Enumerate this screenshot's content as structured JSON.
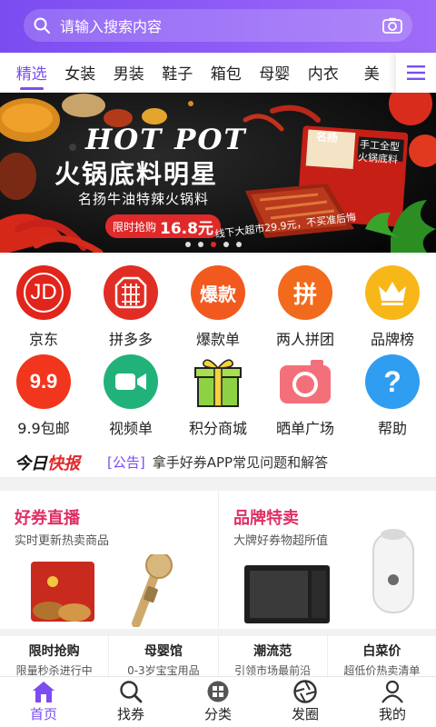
{
  "search": {
    "placeholder": "请输入搜索内容"
  },
  "tabs": [
    "精选",
    "女装",
    "男装",
    "鞋子",
    "箱包",
    "母婴",
    "内衣",
    "美"
  ],
  "banner": {
    "title": "HOT POT",
    "main": "火锅底料明星",
    "sub": "名扬牛油特辣火锅料",
    "price_label": "限时抢购",
    "price": "16.8元",
    "note": "线下大超市29.9元，不买准后悔",
    "pack_text_1": "名扬",
    "pack_text_2": "手工全型",
    "pack_text_3": "火锅底料"
  },
  "icons": [
    {
      "label": "京东",
      "glyph": "JD",
      "color": "#e1251b"
    },
    {
      "label": "拼多多",
      "glyph": "拼",
      "color": "#e02e24"
    },
    {
      "label": "爆款单",
      "glyph": "爆款",
      "color": "#f2591e"
    },
    {
      "label": "两人拼团",
      "glyph": "拼",
      "color": "#f26a1b"
    },
    {
      "label": "品牌榜",
      "glyph": "crown-icon",
      "color": "#f8b718"
    },
    {
      "label": "9.9包邮",
      "glyph": "9.9",
      "color": "#f1361d"
    },
    {
      "label": "视频单",
      "glyph": "video-icon",
      "color": "#21b27a"
    },
    {
      "label": "积分商城",
      "glyph": "gift-icon",
      "color": "#8dd242"
    },
    {
      "label": "晒单广场",
      "glyph": "camera-icon",
      "color": "#f3707a"
    },
    {
      "label": "帮助",
      "glyph": "?",
      "color": "#2f9df0"
    }
  ],
  "news": {
    "logo_a": "今日",
    "logo_b": "快报",
    "tag": "[公告]",
    "headline": "拿手好券APP常见问题和解答"
  },
  "cards": [
    {
      "title": "好券直播",
      "subtitle": "实时更新热卖商品",
      "title_color": "#e02f63"
    },
    {
      "title": "品牌特卖",
      "subtitle": "大牌好券物超所值",
      "title_color": "#e02f63"
    }
  ],
  "quick": [
    {
      "title": "限时抢购",
      "subtitle": "限量秒杀进行中"
    },
    {
      "title": "母婴馆",
      "subtitle": "0-3岁宝宝用品"
    },
    {
      "title": "潮流范",
      "subtitle": "引领市场最前沿"
    },
    {
      "title": "白菜价",
      "subtitle": "超低价热卖清单"
    }
  ],
  "nav": [
    "首页",
    "找券",
    "分类",
    "发圈",
    "我的"
  ],
  "colors": {
    "accent": "#7b4cf0",
    "red": "#e0292b"
  }
}
